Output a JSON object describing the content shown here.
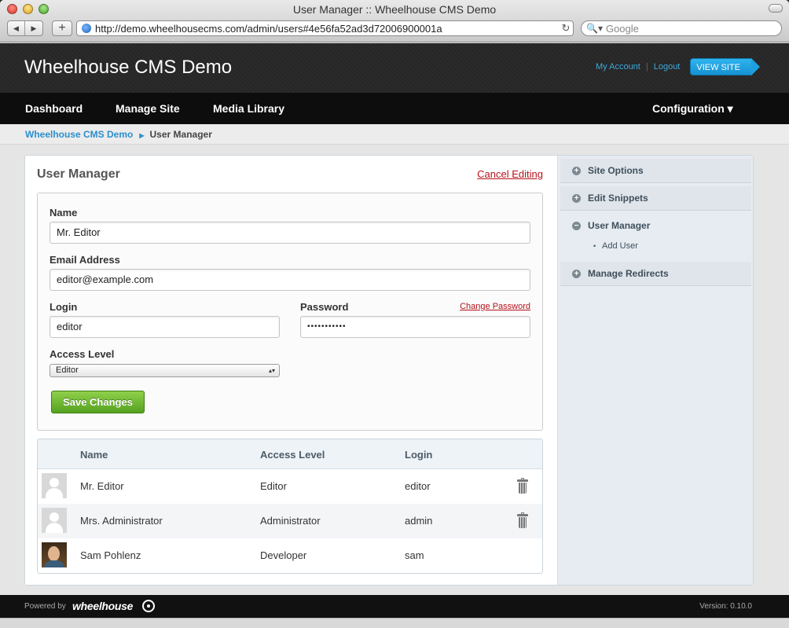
{
  "browser": {
    "window_title": "User Manager :: Wheelhouse CMS Demo",
    "url": "http://demo.wheelhousecms.com/admin/users#4e56fa52ad3d72006900001a",
    "search_placeholder": "Google",
    "back_icon": "◀",
    "forward_icon": "▶",
    "add_icon": "+",
    "reload_icon": "↻",
    "search_icon": "🔍▾"
  },
  "header": {
    "site_title": "Wheelhouse CMS Demo",
    "my_account": "My Account",
    "separator": "|",
    "logout": "Logout",
    "view_site": "VIEW SITE",
    "accent_color": "#1ea0e0"
  },
  "nav": {
    "items": [
      "Dashboard",
      "Manage Site",
      "Media Library"
    ],
    "configuration": "Configuration ▾"
  },
  "breadcrumb": {
    "root": "Wheelhouse CMS Demo",
    "arrow": "▶",
    "current": "User Manager"
  },
  "main": {
    "title": "User Manager",
    "cancel_link": "Cancel Editing",
    "form": {
      "name_label": "Name",
      "name_value": "Mr. Editor",
      "email_label": "Email Address",
      "email_value": "editor@example.com",
      "login_label": "Login",
      "login_value": "editor",
      "password_label": "Password",
      "password_value": "•••••••••••",
      "change_password": "Change Password",
      "access_label": "Access Level",
      "access_value": "Editor",
      "select_caret": "▴▾",
      "save_button": "Save Changes"
    },
    "table": {
      "columns": [
        "Name",
        "Access Level",
        "Login"
      ],
      "rows": [
        {
          "name": "Mr. Editor",
          "access": "Editor",
          "login": "editor",
          "deletable": true
        },
        {
          "name": "Mrs. Administrator",
          "access": "Administrator",
          "login": "admin",
          "deletable": true
        },
        {
          "name": "Sam Pohlenz",
          "access": "Developer",
          "login": "sam",
          "deletable": false
        }
      ]
    }
  },
  "sidebar": {
    "items": [
      {
        "label": "Site Options",
        "icon": "+"
      },
      {
        "label": "Edit Snippets",
        "icon": "+"
      },
      {
        "label": "User Manager",
        "icon": "−",
        "subitem": "Add User"
      },
      {
        "label": "Manage Redirects",
        "icon": "+"
      }
    ]
  },
  "footer": {
    "powered_by": "Powered by",
    "logo": "wheelhouse",
    "version": "Version: 0.10.0"
  }
}
